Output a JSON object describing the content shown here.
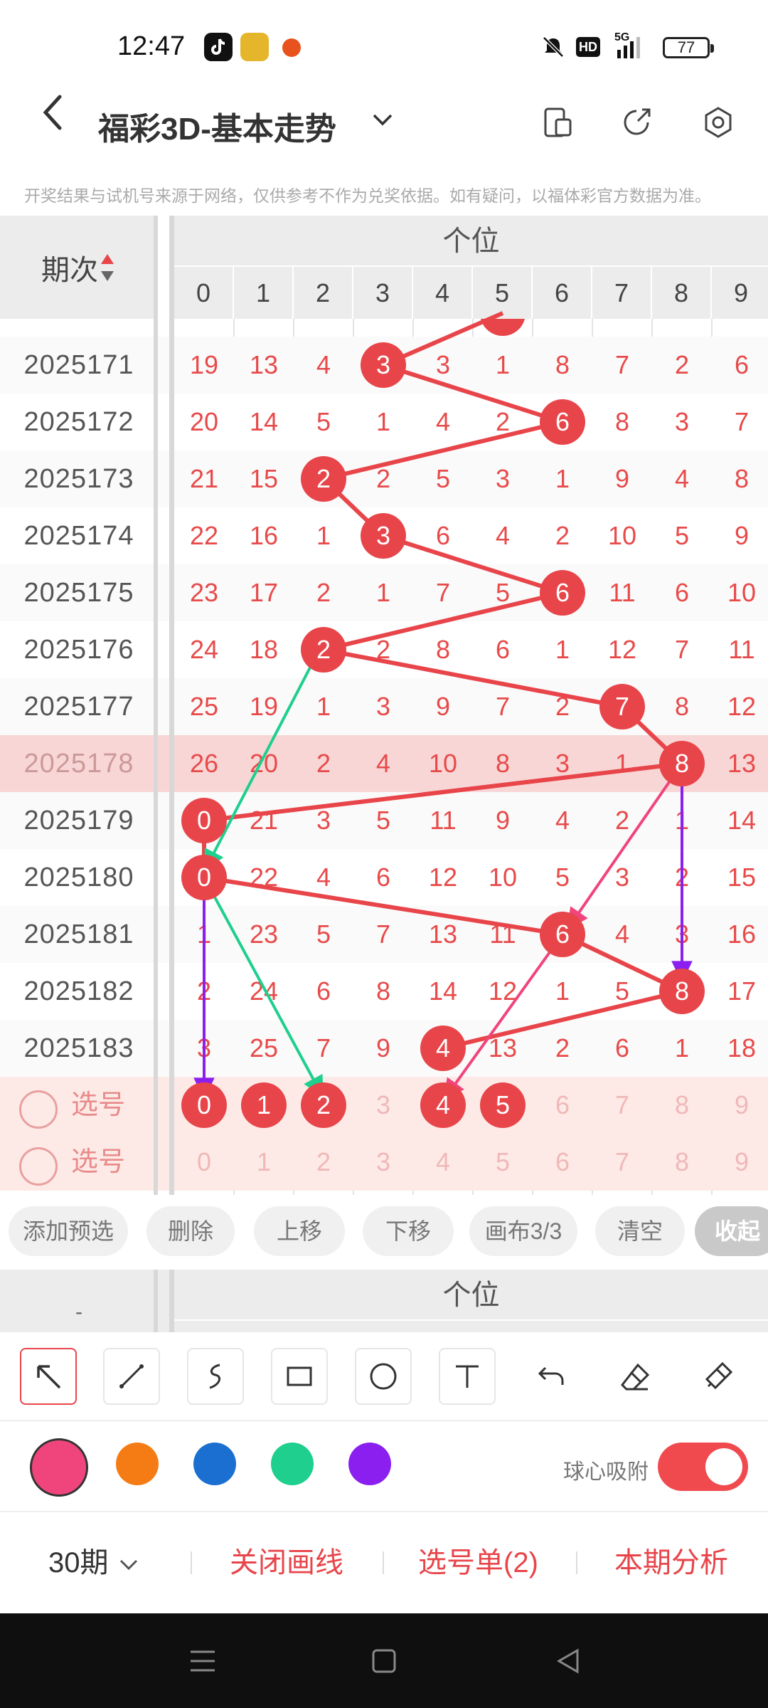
{
  "status_bar": {
    "time": "12:47",
    "battery": "77",
    "network": "5G",
    "hd": "HD",
    "icons": [
      "tiktok-icon",
      "game-app-icon",
      "orange-app-icon",
      "mute-bell-icon",
      "hd-icon",
      "signal-icon",
      "battery-icon"
    ]
  },
  "header": {
    "back_icon": "chevron-left-icon",
    "title": "福彩3D-基本走势",
    "dropdown_icon": "chevron-down-icon",
    "right_icons": [
      "phone-layout-icon",
      "share-arrow-icon",
      "settings-gear-icon"
    ]
  },
  "notice": "开奖结果与试机号来源于网络，仅供参考不作为兑奖依据。如有疑问，以福体彩官方数据为准。",
  "table": {
    "period_header": "期次",
    "group_header": "个位",
    "digit_headers": [
      "0",
      "1",
      "2",
      "3",
      "4",
      "5",
      "6",
      "7",
      "8",
      "9"
    ],
    "rows": [
      {
        "period": "2025171",
        "cells": [
          "19",
          "13",
          "4",
          "3",
          "3",
          "1",
          "8",
          "7",
          "2",
          "6"
        ],
        "hit": 3
      },
      {
        "period": "2025172",
        "cells": [
          "20",
          "14",
          "5",
          "1",
          "4",
          "2",
          "6",
          "8",
          "3",
          "7"
        ],
        "hit": 6
      },
      {
        "period": "2025173",
        "cells": [
          "21",
          "15",
          "2",
          "2",
          "5",
          "3",
          "1",
          "9",
          "4",
          "8"
        ],
        "hit": 2
      },
      {
        "period": "2025174",
        "cells": [
          "22",
          "16",
          "1",
          "3",
          "6",
          "4",
          "2",
          "10",
          "5",
          "9"
        ],
        "hit": 3
      },
      {
        "period": "2025175",
        "cells": [
          "23",
          "17",
          "2",
          "1",
          "7",
          "5",
          "6",
          "11",
          "6",
          "10"
        ],
        "hit": 6
      },
      {
        "period": "2025176",
        "cells": [
          "24",
          "18",
          "2",
          "2",
          "8",
          "6",
          "1",
          "12",
          "7",
          "11"
        ],
        "hit": 2
      },
      {
        "period": "2025177",
        "cells": [
          "25",
          "19",
          "1",
          "3",
          "9",
          "7",
          "2",
          "7",
          "8",
          "12"
        ],
        "hit": 7
      },
      {
        "period": "2025178",
        "cells": [
          "26",
          "20",
          "2",
          "4",
          "10",
          "8",
          "3",
          "1",
          "8",
          "13"
        ],
        "hit": 8
      },
      {
        "period": "2025179",
        "cells": [
          "0",
          "21",
          "3",
          "5",
          "11",
          "9",
          "4",
          "2",
          "1",
          "14"
        ],
        "hit": 0
      },
      {
        "period": "2025180",
        "cells": [
          "0",
          "22",
          "4",
          "6",
          "12",
          "10",
          "5",
          "3",
          "2",
          "15"
        ],
        "hit": 0
      },
      {
        "period": "2025181",
        "cells": [
          "1",
          "23",
          "5",
          "7",
          "13",
          "11",
          "6",
          "4",
          "3",
          "16"
        ],
        "hit": 6
      },
      {
        "period": "2025182",
        "cells": [
          "2",
          "24",
          "6",
          "8",
          "14",
          "12",
          "1",
          "5",
          "8",
          "17"
        ],
        "hit": 8
      },
      {
        "period": "2025183",
        "cells": [
          "3",
          "25",
          "7",
          "9",
          "4",
          "13",
          "2",
          "6",
          "1",
          "18"
        ],
        "hit": 4
      }
    ],
    "pick_rows": [
      {
        "label": "选号",
        "cells": [
          "0",
          "1",
          "2",
          "3",
          "4",
          "5",
          "6",
          "7",
          "8",
          "9"
        ],
        "selected": [
          0,
          1,
          2,
          4,
          5
        ]
      },
      {
        "label": "选号",
        "cells": [
          "0",
          "1",
          "2",
          "3",
          "4",
          "5",
          "6",
          "7",
          "8",
          "9"
        ],
        "selected": []
      }
    ]
  },
  "actions": [
    "添加预选",
    "删除",
    "上移",
    "下移",
    "画布3/3",
    "清空",
    "收起"
  ],
  "table2_header": {
    "left": "-",
    "group": "个位"
  },
  "tools": [
    "arrow-tool-icon",
    "line-tool-icon",
    "freehand-tool-icon",
    "rectangle-tool-icon",
    "circle-tool-icon",
    "text-tool-icon",
    "undo-icon",
    "eraser-icon",
    "clear-brush-icon"
  ],
  "colors": [
    "#f0457c",
    "#f57c14",
    "#1a6fd1",
    "#1ecf8e",
    "#8a1ff0"
  ],
  "toggle": {
    "label": "球心吸附",
    "on": true
  },
  "bottom": {
    "periods": "30期",
    "close_lines": "关闭画线",
    "pick_list": "选号单(2)",
    "analysis": "本期分析"
  },
  "accent": "#e8454a"
}
